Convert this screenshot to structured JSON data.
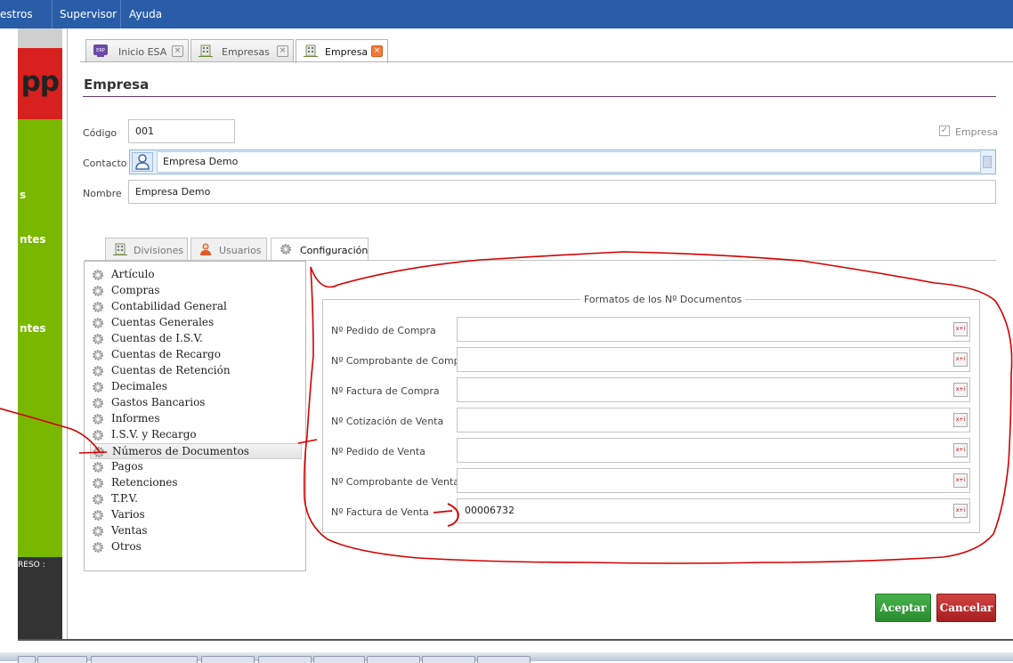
{
  "menubar": {
    "items": [
      "estros",
      "Supervisor",
      "Ayuda"
    ]
  },
  "sidebar": {
    "logo_text": "pp",
    "texts": [
      "s",
      "ntes",
      "ntes",
      "RESO :"
    ]
  },
  "tabs": [
    {
      "label": "Inicio ESA",
      "icon": "erp-icon",
      "active": false
    },
    {
      "label": "Empresas",
      "icon": "building-icon",
      "active": false
    },
    {
      "label": "Empresa",
      "icon": "building-icon",
      "active": true
    }
  ],
  "form": {
    "title": "Empresa",
    "codigo_label": "Código",
    "codigo_value": "001",
    "empresa_checkbox_label": "Empresa",
    "empresa_checked": true,
    "contacto_label": "Contacto",
    "contacto_value": "Empresa Demo",
    "nombre_label": "Nombre",
    "nombre_value": "Empresa Demo"
  },
  "subtabs": [
    {
      "label": "Divisiones",
      "icon": "building-icon",
      "active": false
    },
    {
      "label": "Usuarios",
      "icon": "user-icon",
      "active": false
    },
    {
      "label": "Configuración",
      "icon": "gear-icon",
      "active": true
    }
  ],
  "tree": {
    "items": [
      "Artículo",
      "Compras",
      "Contabilidad General",
      "Cuentas Generales",
      "Cuentas de I.S.V.",
      "Cuentas de Recargo",
      "Cuentas de Retención",
      "Decimales",
      "Gastos Bancarios",
      "Informes",
      "I.S.V. y Recargo",
      "Números de Documentos",
      "Pagos",
      "Retenciones",
      "T.P.V.",
      "Varios",
      "Ventas",
      "Otros"
    ],
    "selected": "Números de Documentos"
  },
  "formats": {
    "legend": "Formatos de los Nº Documentos",
    "rows": [
      {
        "label": "Nº Pedido de Compra",
        "value": ""
      },
      {
        "label": "Nº Comprobante de Compra",
        "value": ""
      },
      {
        "label": "Nº Factura de Compra",
        "value": ""
      },
      {
        "label": "Nº Cotización de Venta",
        "value": ""
      },
      {
        "label": "Nº Pedido de Venta",
        "value": ""
      },
      {
        "label": "Nº Comprobante de Venta",
        "value": ""
      },
      {
        "label": "Nº Factura de Venta",
        "value": "00006732"
      }
    ],
    "row_button_text": "x+i"
  },
  "buttons": {
    "accept": "Aceptar",
    "cancel": "Cancelar"
  },
  "colors": {
    "menubar": "#2a5da8",
    "sidebar_green": "#7ab800",
    "sidebar_red": "#d8201e",
    "accept": "#2e8f33",
    "cancel": "#b52525",
    "annotation": "#d40000"
  }
}
